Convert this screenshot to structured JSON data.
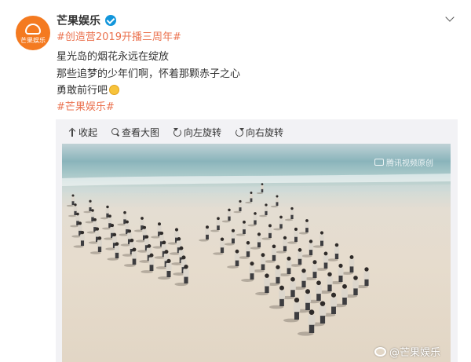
{
  "post": {
    "avatar_text": "芒果娱乐",
    "username": "芒果娱乐",
    "hashtag_top": "#创造营2019开播三周年#",
    "lines": [
      "星光岛的烟花永远在绽放",
      "那些追梦的少年们啊，怀着那颗赤子之心",
      "勇敢前行吧"
    ],
    "hashtag_bottom": "#芒果娱乐#"
  },
  "toolbar": {
    "collapse": "收起",
    "view_large": "查看大图",
    "rotate_left": "向左旋转",
    "rotate_right": "向右旋转"
  },
  "media": {
    "video_watermark": "腾讯视频原创",
    "weibo_watermark": "@芒果娱乐"
  },
  "colors": {
    "link": "#eb7350",
    "avatar": "#f47a20",
    "verified": "#1296db"
  },
  "icons": [
    "verified-icon",
    "chevron-down-icon",
    "collapse-icon",
    "zoom-icon",
    "rotate-left-icon",
    "rotate-right-icon",
    "weibo-icon",
    "video-icon"
  ]
}
